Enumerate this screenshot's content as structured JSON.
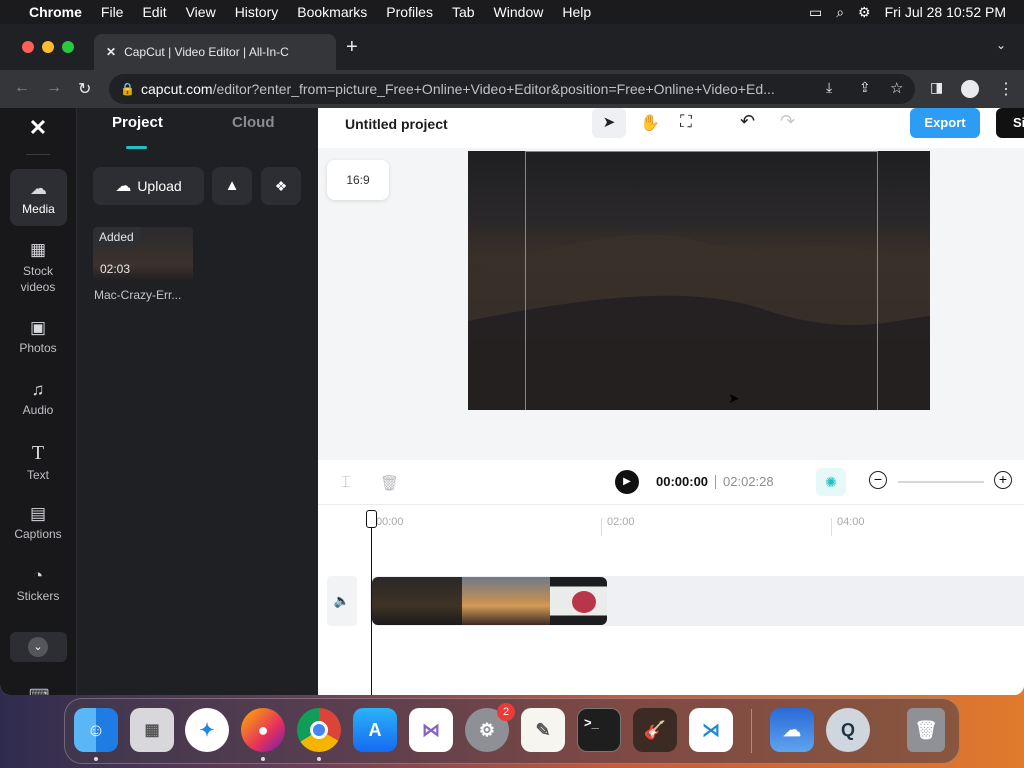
{
  "menubar": {
    "apple": "",
    "app": "Chrome",
    "items": [
      "File",
      "Edit",
      "View",
      "History",
      "Bookmarks",
      "Profiles",
      "Tab",
      "Window",
      "Help"
    ],
    "datetime": "Fri Jul 28  10:52 PM"
  },
  "browser": {
    "tab_title": "CapCut | Video Editor | All-In-C",
    "new_tab": "+",
    "url_domain": "capcut.com",
    "url_path": "/editor?enter_from=picture_Free+Online+Video+Editor&position=Free+Online+Video+Ed..."
  },
  "sidebar": {
    "items": [
      {
        "label": "Media",
        "icon": "cloud-upload-icon"
      },
      {
        "label": "Stock videos",
        "icon": "film-icon"
      },
      {
        "label": "Photos",
        "icon": "image-icon"
      },
      {
        "label": "Audio",
        "icon": "music-icon"
      },
      {
        "label": "Text",
        "icon": "text-icon"
      },
      {
        "label": "Captions",
        "icon": "captions-icon"
      },
      {
        "label": "Stickers",
        "icon": "sticker-icon"
      }
    ]
  },
  "panel": {
    "tab_project": "Project",
    "tab_cloud": "Cloud",
    "upload": "Upload",
    "media": {
      "badge": "Added",
      "duration": "02:03",
      "name": "Mac-Crazy-Err..."
    }
  },
  "editor": {
    "project_title": "Untitled project",
    "export": "Export",
    "share_partial": "Si",
    "aspect": "16:9",
    "current_time": "00:00:00",
    "total_time": "02:02:28",
    "ruler": [
      "00:00",
      "02:00",
      "04:00"
    ]
  },
  "dock": {
    "apps": [
      "Finder",
      "Launchpad",
      "Safari",
      "Firefox",
      "Chrome",
      "App Store",
      "Visual Studio",
      "System Settings",
      "TextEdit",
      "Terminal",
      "GarageBand",
      "VS Code",
      "Weather",
      "QuickTime",
      "Trash"
    ],
    "settings_badge": "2"
  },
  "colors": {
    "accent": "#1fc2c2",
    "export": "#2d9cf5",
    "rail": "#18181b",
    "panel": "#1f2024"
  }
}
